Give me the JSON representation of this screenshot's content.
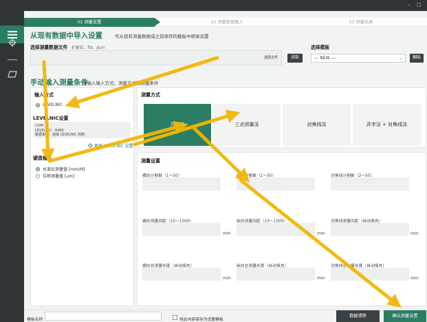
{
  "window": {
    "minimize": "–",
    "maximize": "□"
  },
  "steps": [
    "01 测量设置",
    "02 测量数据输入",
    "03 测量结果"
  ],
  "import_section": {
    "title": "从现有数据中导入设置",
    "subtitle": "可从现有测量数据或之前保存的模板中继承设置",
    "file_label": "选择测量数据文件",
    "file_hint": "扩展名：fld，json",
    "choose_file_btn": "选择文件",
    "load_btn": "读取",
    "template_label": "选择模板",
    "template_value": "--- NEW ---",
    "delete_btn": "删除"
  },
  "manual_section": {
    "title": "手动输入测量条件",
    "subtitle": "请输入输入方式、测量方式和测量条件"
  },
  "input_method": {
    "title": "输入方式",
    "option": "LEVELNIC",
    "levelnic_title": "LEVELNIC设置",
    "levelnic_info": [
      "COM：4",
      "LEVELNIC：6489",
      "数据来源：连接 LEVELNIC 控制"
    ],
    "change_btn": "更改 LEVELNIC 设置",
    "keyboard_title": "键盘输入",
    "keyboard_options": [
      "水准仪测量值 [mm/M]",
      "位移测量值 [um]"
    ]
  },
  "method": {
    "title": "测量方式",
    "options": [
      "方格法",
      "三点测量法",
      "对角线法",
      "井字法 + 对角线法"
    ]
  },
  "settings": {
    "title": "测量设置",
    "fields": [
      {
        "label": "横向分割数（1〜50）",
        "unit": ""
      },
      {
        "label": "纵向分割数（1〜50）",
        "unit": ""
      },
      {
        "label": "对角线分割数（2〜50）",
        "unit": ""
      },
      {
        "label": "横向测量间距（10〜1000）",
        "unit": "mm"
      },
      {
        "label": "纵向测量间距（10〜1000）",
        "unit": "mm"
      },
      {
        "label": "对角线测量间距（自动填充）",
        "unit": "mm"
      },
      {
        "label": "横向总测量长度（自动填充）",
        "unit": "mm"
      },
      {
        "label": "纵向总测量长度（自动填充）",
        "unit": "mm"
      },
      {
        "label": "对角线总测量长度（自动填充）",
        "unit": "mm"
      }
    ]
  },
  "bottom": {
    "template_name_label": "模板名称",
    "save_checkbox_label": "将此内容保存为设置模板",
    "clear_btn": "数据清除",
    "confirm_btn": "确认测量设置"
  },
  "colors": {
    "accent": "#2b7d63",
    "dark": "#2f3537",
    "arrow": "#f2b705"
  }
}
